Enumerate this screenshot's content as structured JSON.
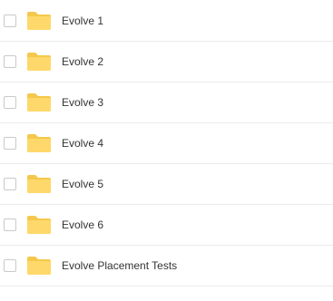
{
  "colors": {
    "folder_back": "#f5c84b",
    "folder_front": "#fed86a",
    "text": "#333333",
    "divider": "#ececec",
    "checkbox_border": "#c9c9c9"
  },
  "file_list": {
    "items": [
      {
        "name": "Evolve 1",
        "icon": "folder-icon",
        "checked": false
      },
      {
        "name": "Evolve 2",
        "icon": "folder-icon",
        "checked": false
      },
      {
        "name": "Evolve 3",
        "icon": "folder-icon",
        "checked": false
      },
      {
        "name": "Evolve 4",
        "icon": "folder-icon",
        "checked": false
      },
      {
        "name": "Evolve 5",
        "icon": "folder-icon",
        "checked": false
      },
      {
        "name": "Evolve 6",
        "icon": "folder-icon",
        "checked": false
      },
      {
        "name": "Evolve Placement Tests",
        "icon": "folder-icon",
        "checked": false
      }
    ]
  }
}
